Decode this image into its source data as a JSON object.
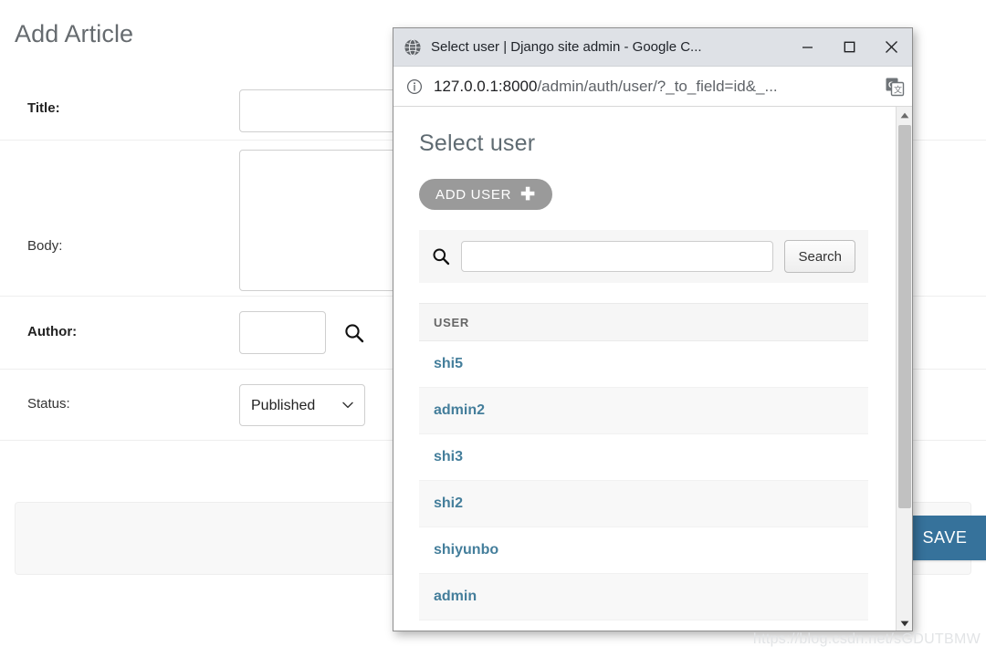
{
  "background_page": {
    "title": "Add Article",
    "fields": [
      {
        "label": "Title:",
        "required": true,
        "type": "text",
        "value": ""
      },
      {
        "label": "Body:",
        "required": false,
        "type": "textarea",
        "value": ""
      },
      {
        "label": "Author:",
        "required": true,
        "type": "lookup",
        "value": ""
      },
      {
        "label": "Status:",
        "required": false,
        "type": "select",
        "value": "Published"
      }
    ],
    "save_button": "SAVE",
    "lookup_icon": "search-icon",
    "select_arrow_icon": "chevron-down-icon"
  },
  "popup_window": {
    "titlebar": {
      "favicon": "globe-icon",
      "title": "Select user | Django site admin - Google C...",
      "minimize": "minimize-icon",
      "maximize": "maximize-icon",
      "close": "close-icon"
    },
    "addressbar": {
      "info_icon": "info-circle-icon",
      "url_host": "127.0.0.1:8000",
      "url_path": "/admin/auth/user/?_to_field=id&_...",
      "translate_icon": "translate-icon"
    },
    "content": {
      "heading": "Select user",
      "add_button": {
        "label": "ADD USER",
        "icon": "plus-icon"
      },
      "search": {
        "icon": "search-icon",
        "value": "",
        "placeholder": "",
        "button_label": "Search"
      },
      "results": {
        "column_header": "USER",
        "rows": [
          {
            "username": "shi5"
          },
          {
            "username": "admin2"
          },
          {
            "username": "shi3"
          },
          {
            "username": "shi2"
          },
          {
            "username": "shiyunbo"
          },
          {
            "username": "admin"
          }
        ]
      }
    },
    "scrollbar": {
      "up_icon": "triangle-up-icon",
      "down_icon": "triangle-down-icon"
    }
  },
  "watermark": "https://blog.csdn.net/sGDUTBMW",
  "colors": {
    "save_button": "#36729b",
    "link": "#447e9b",
    "add_user_button": "#9a9a9a",
    "titlebar": "#dee1e6",
    "row_alt": "#f8f8f8"
  }
}
